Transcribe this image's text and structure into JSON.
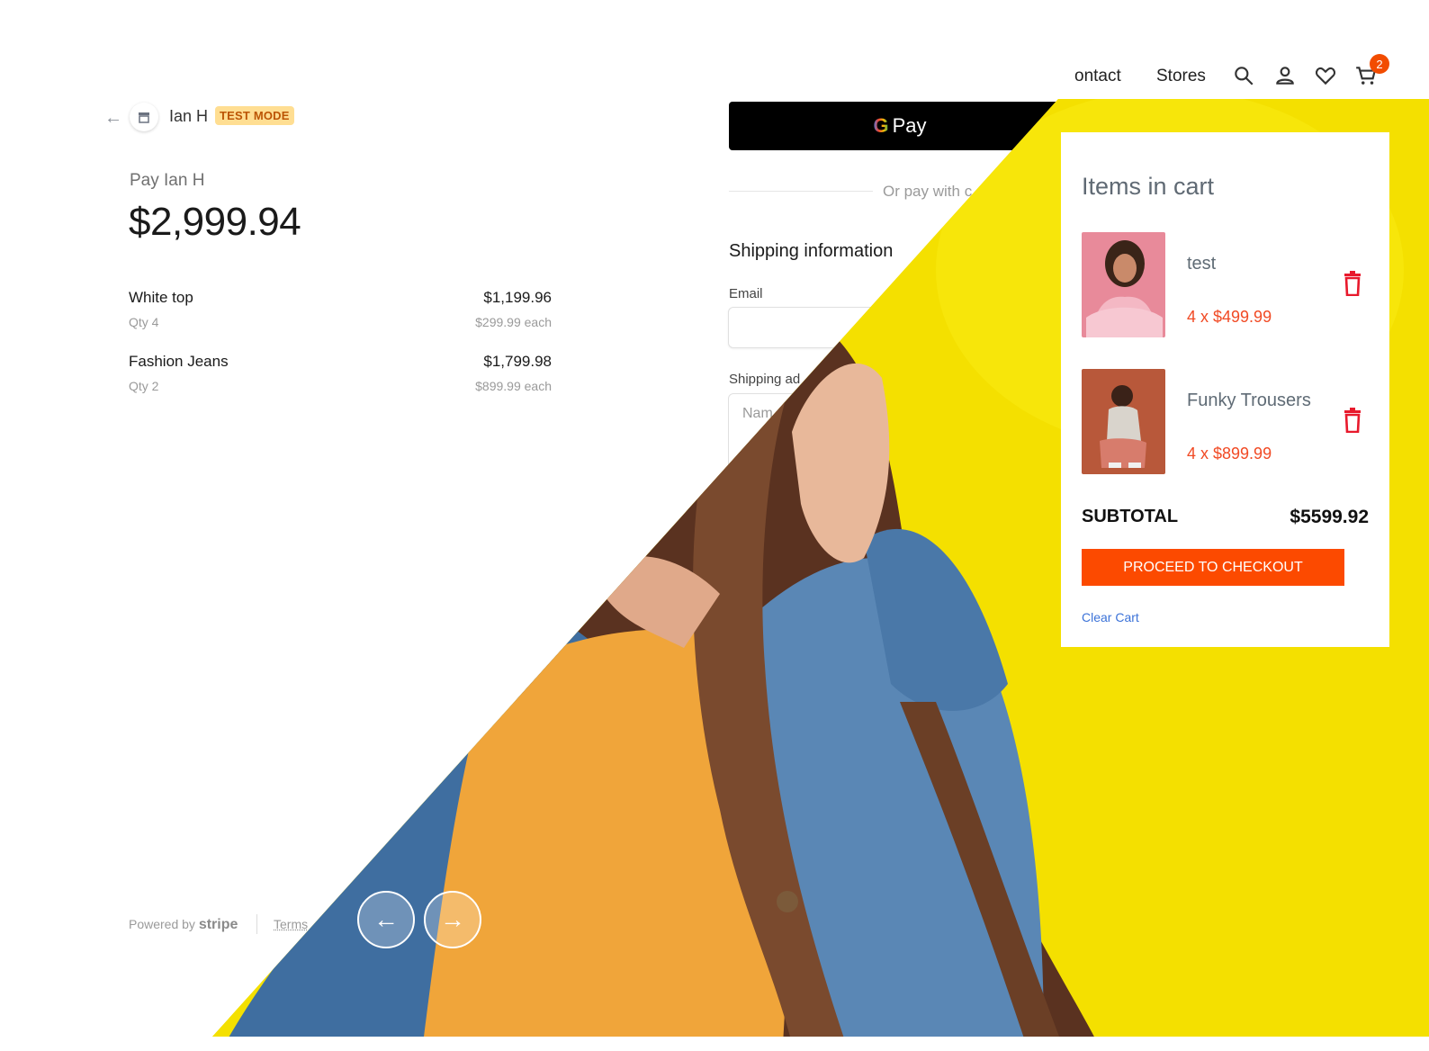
{
  "stripe": {
    "merchant_name": "Ian H",
    "test_mode_badge": "TEST MODE",
    "pay_label": "Pay Ian H",
    "amount": "$2,999.94",
    "line_items": [
      {
        "name": "White top",
        "qty": "Qty 4",
        "total": "$1,199.96",
        "each": "$299.99 each"
      },
      {
        "name": "Fashion Jeans",
        "qty": "Qty 2",
        "total": "$1,799.98",
        "each": "$899.99 each"
      }
    ],
    "powered_by": "Powered by",
    "stripe_word": "stripe",
    "terms": "Terms"
  },
  "checkout": {
    "gpay_label": "Pay",
    "gpay_g": "G",
    "or_pay_with": "Or pay with c",
    "shipping_title": "Shipping information",
    "email_label": "Email",
    "shipping_address_label": "Shipping ad",
    "name_placeholder": "Nam"
  },
  "nav": {
    "items": [
      "ontact",
      "Stores"
    ],
    "icons": [
      "search-icon",
      "user-icon",
      "heart-icon",
      "cart-icon"
    ],
    "cart_count": "2"
  },
  "cart": {
    "title": "Items in cart",
    "items": [
      {
        "name": "test",
        "price": "4 x $499.99"
      },
      {
        "name": "Funky Trousers",
        "price": "4 x $899.99"
      }
    ],
    "subtotal_label": "SUBTOTAL",
    "subtotal_value": "$5599.92",
    "checkout_button": "PROCEED TO CHECKOUT",
    "clear_cart": "Clear Cart"
  },
  "carousel": {
    "prev_icon": "arrow-left-icon",
    "next_icon": "arrow-right-icon"
  },
  "colors": {
    "accent": "#fc4a00",
    "badge": "#f24c00",
    "price": "#f14a24",
    "hero_yellow": "#f4e000",
    "test_badge_bg": "#ffde92",
    "link": "#3b72d8"
  }
}
